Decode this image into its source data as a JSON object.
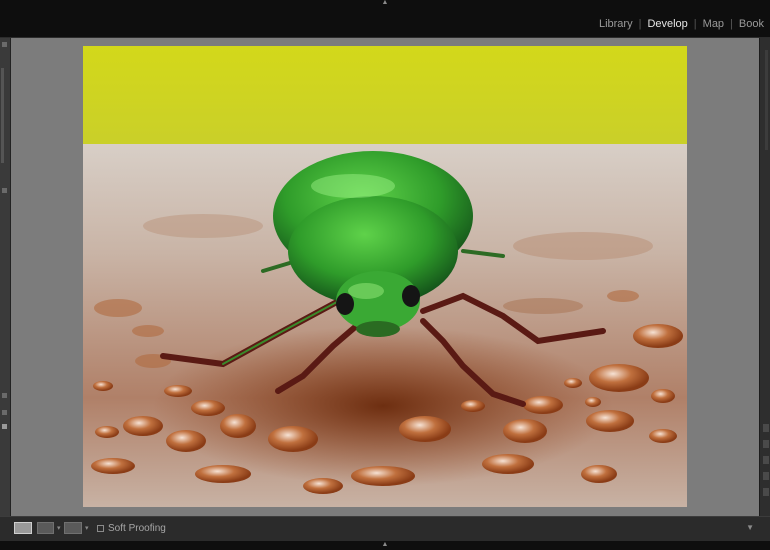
{
  "header": {
    "modules": [
      {
        "label": "Library",
        "active": false
      },
      {
        "label": "Develop",
        "active": true
      },
      {
        "label": "Map",
        "active": false
      },
      {
        "label": "Book",
        "active": false
      }
    ],
    "separator": "|",
    "collapse_glyph": "▲"
  },
  "photo": {
    "subject": "green beetle on wet wooden surface with water droplets",
    "colors": {
      "background_yellow": "#d6dc1a",
      "beetle_green": "#2fa12f",
      "wood": "#9a4a1e"
    }
  },
  "toolbar": {
    "view_buttons": [
      "loupe-view",
      "before-after-left-right",
      "before-after-top-bottom"
    ],
    "soft_proofing_label": "Soft Proofing",
    "soft_proofing_checked": false,
    "menu_glyph": "▼"
  },
  "footer": {
    "collapse_glyph": "▲"
  }
}
